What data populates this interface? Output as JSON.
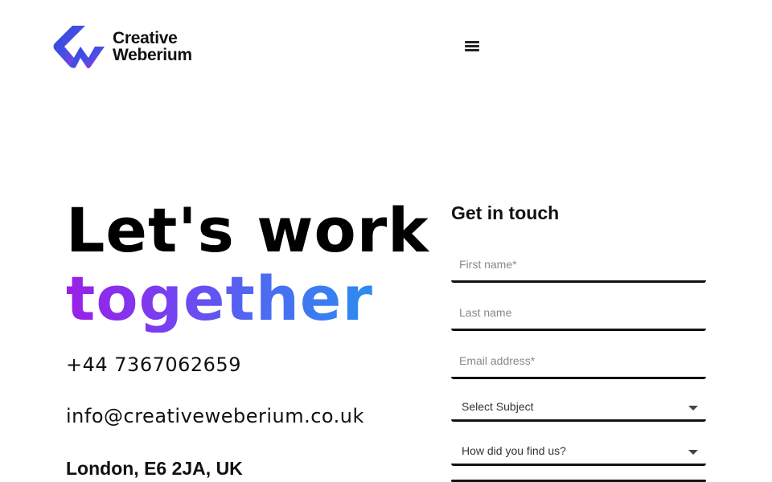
{
  "header": {
    "logo": {
      "line1": "Creative",
      "line2": "Weberium"
    },
    "menu_icon": "hamburger-menu-icon"
  },
  "hero": {
    "title_line1": "Let's work",
    "title_line2": "together",
    "gradient_colors": [
      "#9b1fe8",
      "#7b3cf0",
      "#5067f2",
      "#2c8cf0"
    ]
  },
  "contact": {
    "phone": "+44 7367062659",
    "email": "info@creativeweberium.co.uk",
    "address": "London, E6 2JA, UK"
  },
  "form": {
    "title": "Get in touch",
    "first_name_placeholder": "First name*",
    "last_name_placeholder": "Last name",
    "email_placeholder": "Email address*",
    "subject_selected": "Select Subject",
    "source_selected": "How did you find us?"
  },
  "colors": {
    "text": "#111111",
    "background": "#ffffff",
    "placeholder": "#888888"
  }
}
